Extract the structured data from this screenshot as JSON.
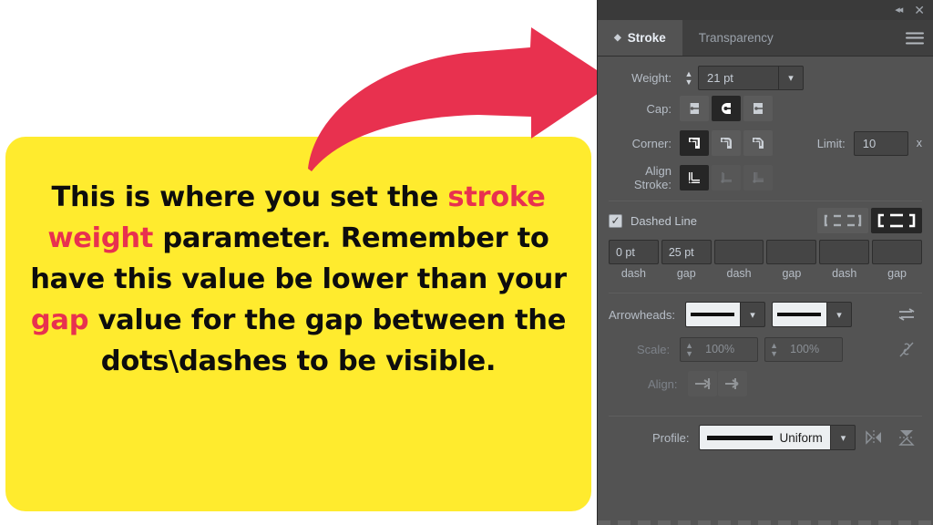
{
  "callout": {
    "segments": [
      {
        "text": "This is where you set the ",
        "accent": false
      },
      {
        "text": "stroke weight",
        "accent": true
      },
      {
        "text": " parameter. Remember to have this value be lower than your ",
        "accent": false
      },
      {
        "text": "gap",
        "accent": true
      },
      {
        "text": " value for the gap between the dots\\dashes to be visible.",
        "accent": false
      }
    ],
    "full_text": "This is where you set the stroke weight parameter. Remember to have this value be lower than your gap value for the gap between the dots\\dashes to be visible.",
    "bg_color": "#ffeb2e",
    "text_color": "#0d0d0d",
    "accent_color": "#e8314f"
  },
  "arrow": {
    "color": "#e8314f",
    "direction": "curved-right"
  },
  "panel": {
    "titlebar": {
      "collapse_icon": "double-chevron-left-icon",
      "close_icon": "close-icon"
    },
    "tabs": [
      {
        "label": "Stroke",
        "active": true
      },
      {
        "label": "Transparency",
        "active": false
      }
    ],
    "menu_icon": "hamburger-menu-icon",
    "weight": {
      "label": "Weight:",
      "value": "21 pt",
      "stepper_icon": "up-down-stepper-icon",
      "dropdown_icon": "chevron-down-icon"
    },
    "cap": {
      "label": "Cap:",
      "options": [
        "butt-cap",
        "round-cap",
        "projecting-cap"
      ],
      "selected": 1
    },
    "corner": {
      "label": "Corner:",
      "options": [
        "miter-join",
        "round-join",
        "bevel-join"
      ],
      "selected": 0,
      "limit_label": "Limit:",
      "limit_value": "10",
      "limit_unit": "x"
    },
    "align_stroke": {
      "label": "Align Stroke:",
      "options": [
        "align-center",
        "align-inside",
        "align-outside"
      ],
      "selected": 0
    },
    "dashed_line": {
      "label": "Dashed Line",
      "checked": true,
      "modes": [
        "preserve-exact-dash-lengths",
        "align-dashes-to-corners"
      ],
      "selected_mode": 1,
      "fields": [
        {
          "value": "0 pt",
          "caption": "dash"
        },
        {
          "value": "25 pt",
          "caption": "gap"
        },
        {
          "value": "",
          "caption": "dash"
        },
        {
          "value": "",
          "caption": "gap"
        },
        {
          "value": "",
          "caption": "dash"
        },
        {
          "value": "",
          "caption": "gap"
        }
      ]
    },
    "arrowheads": {
      "label": "Arrowheads:",
      "start_value": "None",
      "end_value": "None",
      "swap_icon": "swap-arrowheads-icon",
      "dropdown_icon": "chevron-down-icon"
    },
    "scale": {
      "label": "Scale:",
      "start_value": "100%",
      "end_value": "100%",
      "link_icon": "link-broken-icon",
      "disabled": true
    },
    "align": {
      "label": "Align:",
      "options": [
        "extend-arrow-beyond-end",
        "place-arrow-at-end"
      ],
      "disabled": true
    },
    "profile": {
      "label": "Profile:",
      "value": "Uniform",
      "dropdown_icon": "chevron-down-icon",
      "flip_along_icon": "flip-along-icon",
      "flip_across_icon": "flip-across-icon"
    }
  }
}
